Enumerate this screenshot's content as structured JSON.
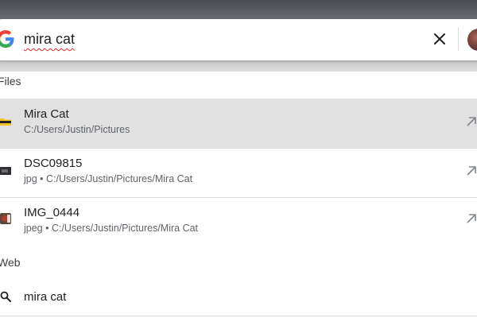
{
  "search": {
    "query": "mira cat"
  },
  "sections": {
    "files": "Files",
    "web": "Web"
  },
  "files": [
    {
      "title": "Mira Cat",
      "subtitle": "C:/Users/Justin/Pictures",
      "icon": "folder-icon",
      "selected": true
    },
    {
      "title": "DSC09815",
      "subtitle": "jpg • C:/Users/Justin/Pictures/Mira Cat",
      "icon": "image-thumbnail",
      "selected": false
    },
    {
      "title": "IMG_0444",
      "subtitle": "jpeg • C:/Users/Justin/Pictures/Mira Cat",
      "icon": "image-thumbnail",
      "selected": false
    }
  ],
  "web": [
    {
      "query": "mira cat",
      "icon": "search-icon"
    }
  ],
  "colors": {
    "selected_row": "#e1e1e1",
    "divider": "#dadce0",
    "primary_text": "#202124",
    "secondary_text": "#5f6368"
  }
}
